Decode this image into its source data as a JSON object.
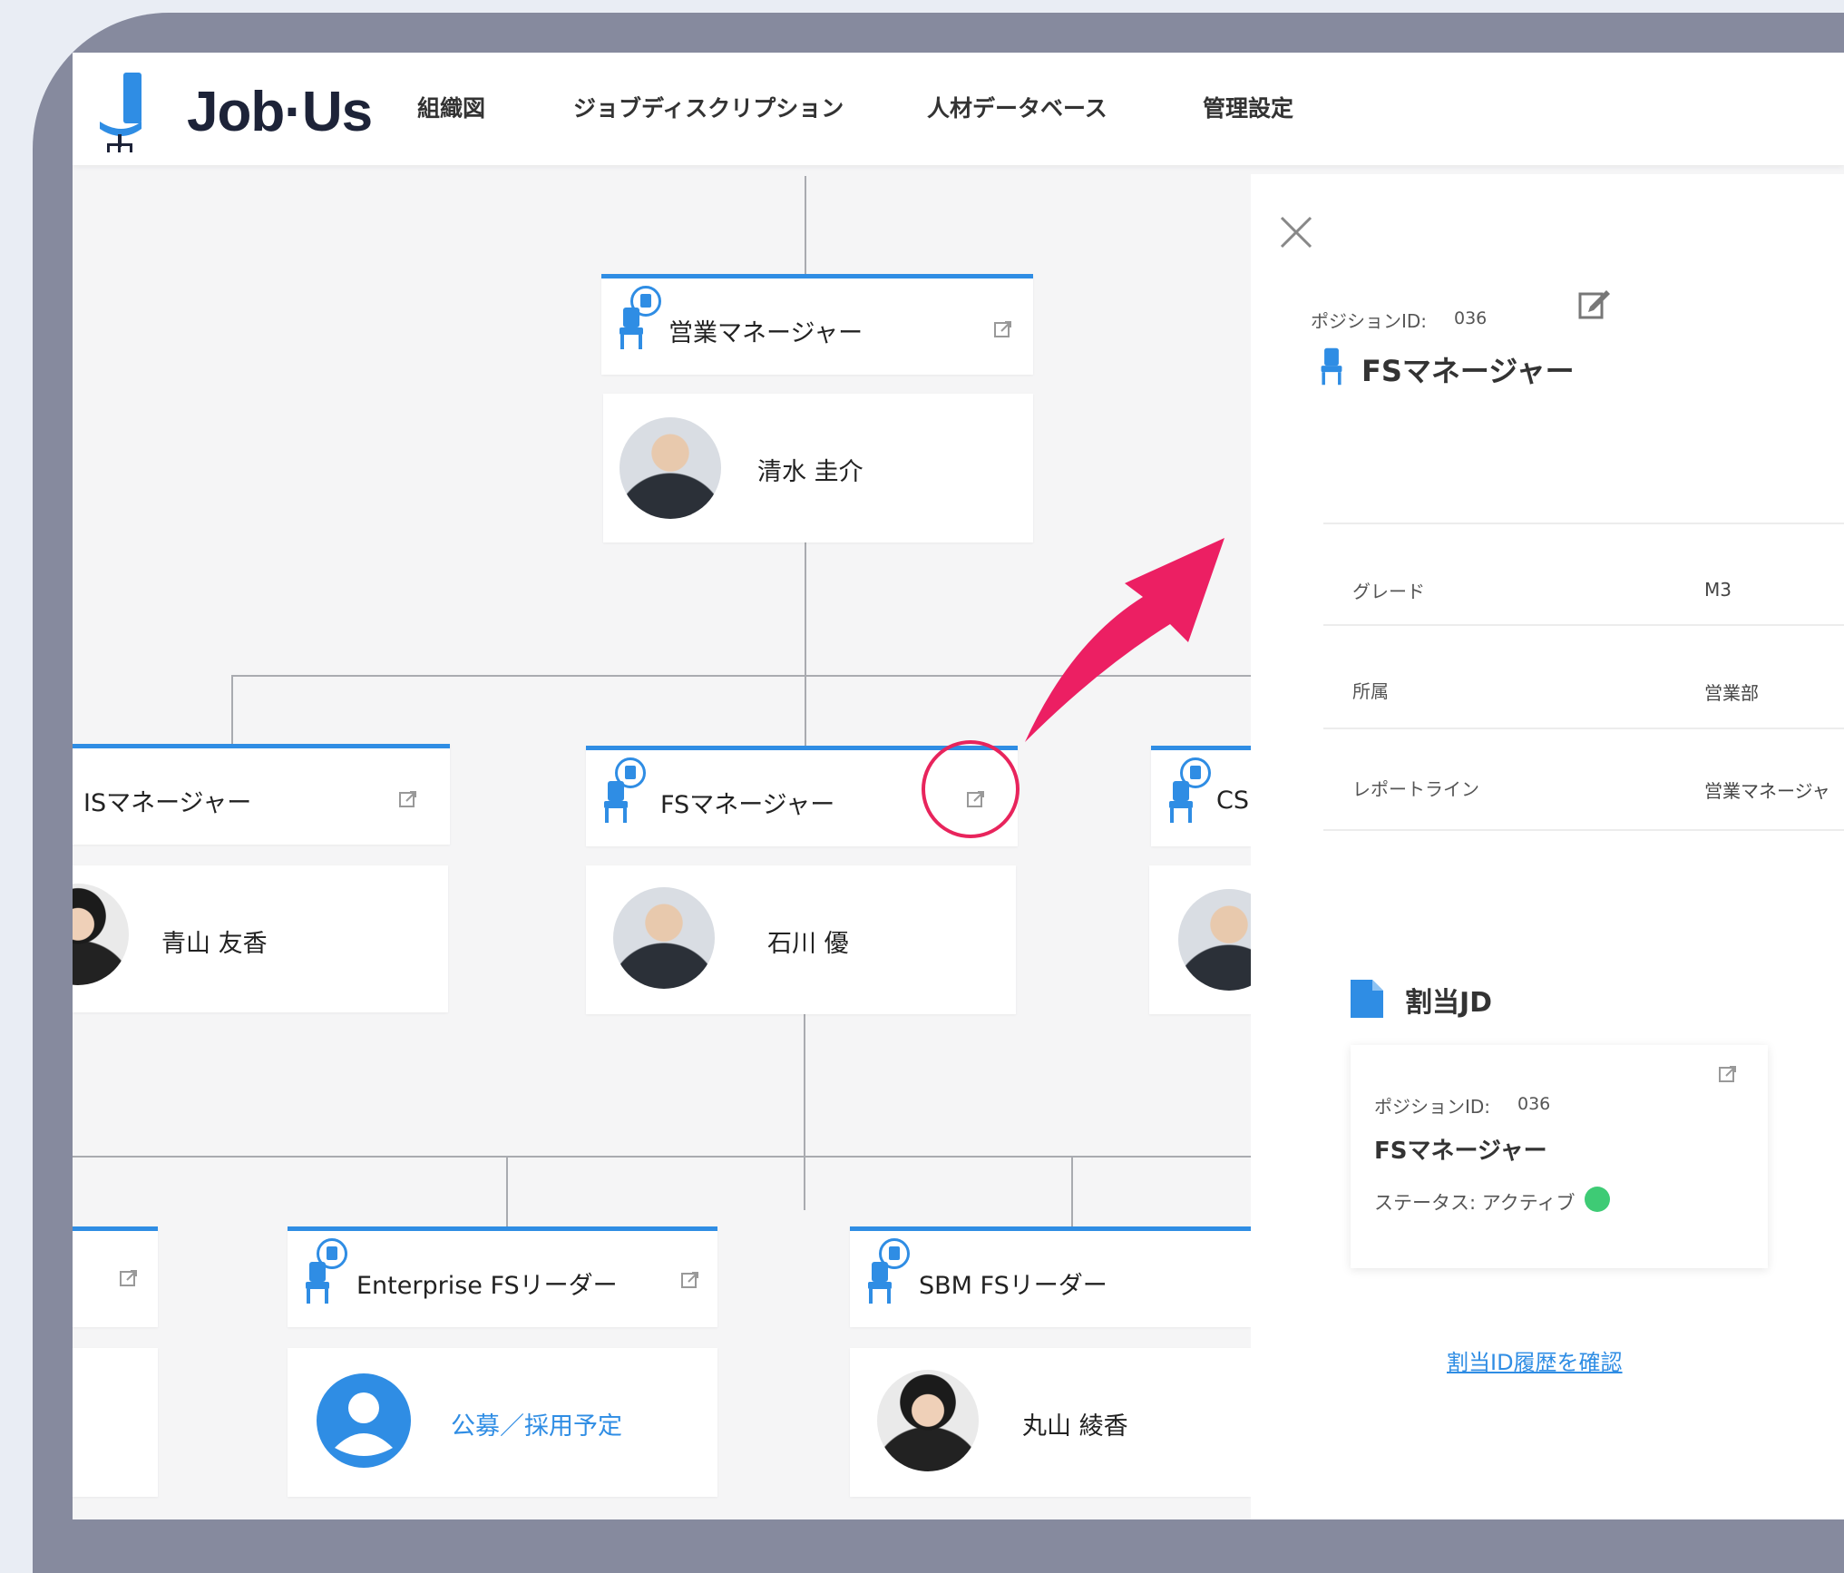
{
  "app": {
    "logo_text": "Job·Us",
    "nav": [
      "組織図",
      "ジョブディスクリプション",
      "人材データベース",
      "管理設定"
    ]
  },
  "org": {
    "top": {
      "position": "営業マネージャー",
      "person": "清水 圭介"
    },
    "mid": [
      {
        "position": "ISマネージャー",
        "person": "青山 友香"
      },
      {
        "position": "FSマネージャー",
        "person": "石川 優"
      },
      {
        "position": "CS",
        "person": ""
      }
    ],
    "bottom": [
      {
        "position": "Enterprise FSリーダー",
        "person": "公募／採用予定"
      },
      {
        "position": "SBM FSリーダー",
        "person": "丸山 綾香"
      }
    ]
  },
  "panel": {
    "position_id_label": "ポジションID:",
    "position_id": "036",
    "title": "FSマネージャー",
    "rows": [
      {
        "label": "グレード",
        "value": "M3"
      },
      {
        "label": "所属",
        "value": "営業部"
      },
      {
        "label": "レポートライン",
        "value": "営業マネージャ"
      }
    ],
    "jd_section_title": "割当JD",
    "jd": {
      "position_id_label": "ポジションID:",
      "position_id": "036",
      "title": "FSマネージャー",
      "status": "ステータス: アクティブ"
    },
    "history_link": "割当ID履歴を確認"
  },
  "colors": {
    "accent": "#2f8de4",
    "highlight": "#e8245c",
    "status_active": "#3ecb75"
  }
}
